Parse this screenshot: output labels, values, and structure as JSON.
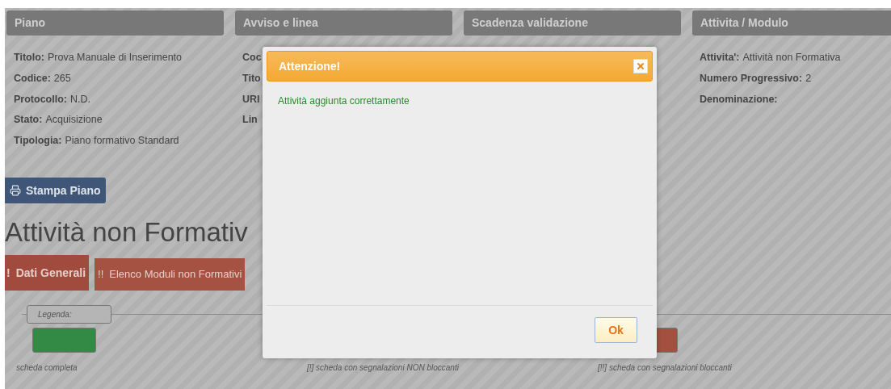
{
  "panels": [
    {
      "title": "Piano",
      "fields": [
        {
          "label": "Titolo:",
          "value": "Prova Manuale di Inserimento"
        },
        {
          "label": "Codice:",
          "value": "265"
        },
        {
          "label": "Protocollo:",
          "value": "N.D."
        },
        {
          "label": "Stato:",
          "value": "Acquisizione"
        },
        {
          "label": "Tipologia:",
          "value": "Piano formativo Standard"
        }
      ]
    },
    {
      "title": "Avviso e linea",
      "fields": [
        {
          "label": "Coc"
        },
        {
          "label": "Tito"
        },
        {
          "label": "URI"
        },
        {
          "label": "Lin"
        }
      ]
    },
    {
      "title": "Scadenza validazione"
    },
    {
      "title": "Attivita / Modulo",
      "fields": [
        {
          "label": "Attivita':",
          "value": "Attività non Formativa"
        },
        {
          "label": "Numero Progressivo:",
          "value": "2"
        },
        {
          "label": "Denominazione:"
        }
      ]
    }
  ],
  "print_button": "Stampa Piano",
  "heading": "Attività non Formativ",
  "tabs": [
    {
      "marker": "!",
      "label": "Dati Generali",
      "selected": true
    },
    {
      "marker": "!!",
      "label": "Elenco Moduli non Formativi",
      "selected": false
    }
  ],
  "legend": {
    "title": "Legenda:",
    "items": [
      {
        "color": "#338a45",
        "caption": "scheda completa"
      },
      {
        "caption": "[!] scheda con segnalazioni NON bloccanti"
      },
      {
        "color": "#a35040",
        "caption": "[!!] scheda con segnalazioni bloccanti"
      }
    ]
  },
  "dialog": {
    "title": "Attenzione!",
    "message": "Attività aggiunta correttamente",
    "ok": "Ok"
  }
}
